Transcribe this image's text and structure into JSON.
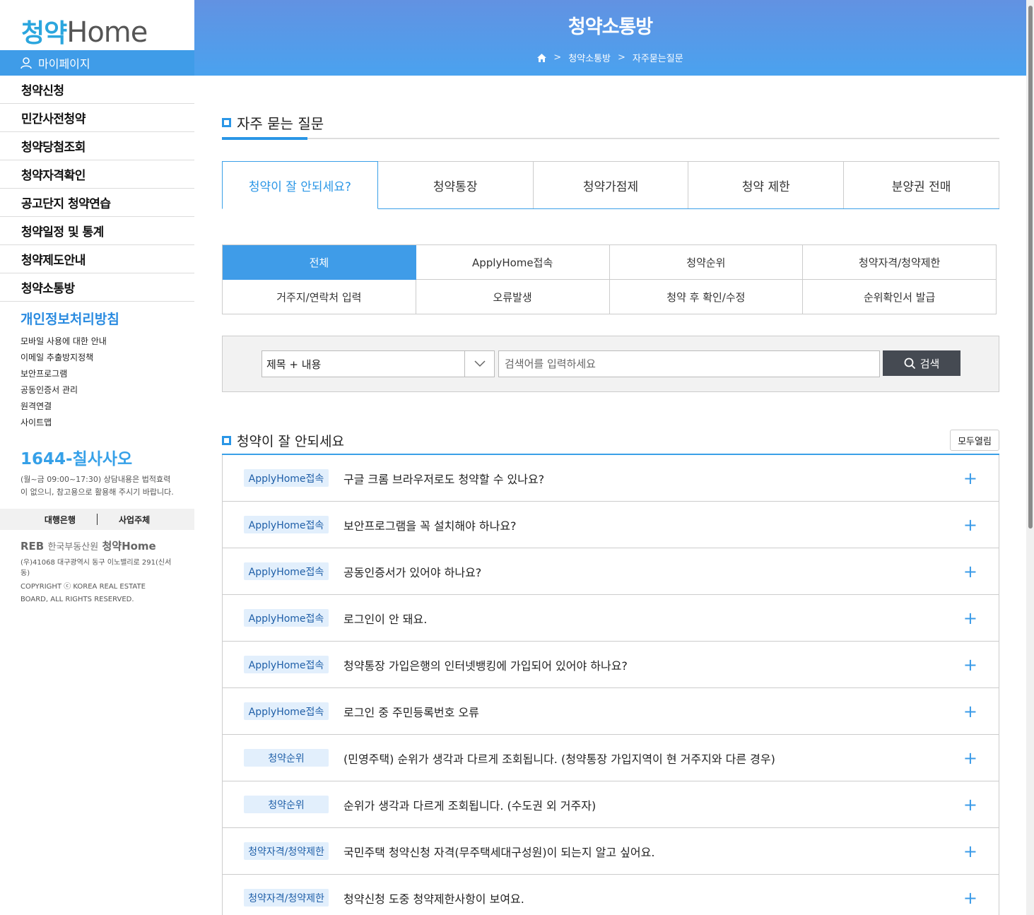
{
  "sidebar": {
    "logo_a": "청약",
    "logo_b": "Home",
    "mypage": "마이페이지",
    "menu": [
      "청약신청",
      "민간사전청약",
      "청약당첨조회",
      "청약자격확인",
      "공고단지 청약연습",
      "청약일정 및 통계",
      "청약제도안내",
      "청약소통방"
    ],
    "privacy": "개인정보처리방침",
    "links": [
      "모바일 사용에 대한 안내",
      "이메일 추출방지정책",
      "보안프로그램",
      "공동인증서 관리",
      "원격연결",
      "사이트맵"
    ],
    "phone": "1644-칠사사오",
    "hours": "(월~금 09:00~17:30) 상담내용은 법적효력이 없으니, 참고용으로 활용해 주시기 바랍니다.",
    "bank": "대행은행",
    "business": "사업주체",
    "footer_logo": "REB",
    "footer_corp": "한국부동산원",
    "footer_brand": "청약Home",
    "address": "(우)41068 대구광역시 동구 이노밸리로 291(신서동)",
    "copyright": "COPYRIGHT ⓒ KOREA REAL ESTATE BOARD, ALL RIGHTS RESERVED."
  },
  "header": {
    "title": "청약소통방",
    "breadcrumb": [
      "청약소통방",
      "자주묻는질문"
    ]
  },
  "main": {
    "section_title": "자주 묻는 질문",
    "tabs": [
      "청약이 잘 안되세요?",
      "청약통장",
      "청약가점제",
      "청약 제한",
      "분양권 전매"
    ],
    "categories": [
      "전체",
      "ApplyHome접속",
      "청약순위",
      "청약자격/청약제한",
      "거주지/연락처 입력",
      "오류발생",
      "청약 후 확인/수정",
      "순위확인서 발급"
    ],
    "search": {
      "select_value": "제목 + 내용",
      "placeholder": "검색어를 입력하세요",
      "button": "검색"
    },
    "list_title": "청약이 잘 안되세요",
    "open_all": "모두열림",
    "faqs": [
      {
        "badge": "ApplyHome접속",
        "question": "구글 크롬 브라우저로도 청약할 수 있나요?"
      },
      {
        "badge": "ApplyHome접속",
        "question": "보안프로그램을 꼭 설치해야 하나요?"
      },
      {
        "badge": "ApplyHome접속",
        "question": "공동인증서가 있어야 하나요?"
      },
      {
        "badge": "ApplyHome접속",
        "question": "로그인이 안 돼요."
      },
      {
        "badge": "ApplyHome접속",
        "question": "청약통장 가입은행의 인터넷뱅킹에 가입되어 있어야 하나요?"
      },
      {
        "badge": "ApplyHome접속",
        "question": "로그인 중 주민등록번호 오류"
      },
      {
        "badge": "청약순위",
        "question": "(민영주택) 순위가 생각과 다르게 조회됩니다. (청약통장 가입지역이 현 거주지와 다른 경우)"
      },
      {
        "badge": "청약순위",
        "question": "순위가 생각과 다르게 조회됩니다. (수도권 외 거주자)"
      },
      {
        "badge": "청약자격/청약제한",
        "question": "국민주택 청약신청 자격(무주택세대구성원)이 되는지 알고 싶어요."
      },
      {
        "badge": "청약자격/청약제한",
        "question": "청약신청 도중 청약제한사항이 보여요."
      }
    ]
  },
  "colors": {
    "accent": "#3f9ce8",
    "header_top": "#6292e2",
    "search_button": "#454a52",
    "badge_bg": "#e2effc"
  }
}
